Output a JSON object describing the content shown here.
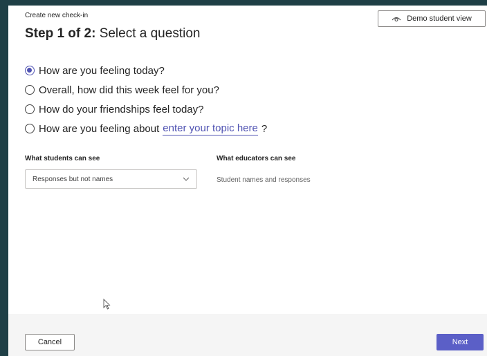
{
  "header": {
    "eyebrow": "Create new check-in",
    "step_prefix": "Step 1 of 2:",
    "step_title": "Select a question",
    "demo_button_label": "Demo student view",
    "demo_icon": "eye-icon"
  },
  "questions": [
    {
      "label": "How are you feeling today?",
      "selected": true
    },
    {
      "label": "Overall, how did this week feel for you?",
      "selected": false
    },
    {
      "label": "How do your friendships feel today?",
      "selected": false
    },
    {
      "label_prefix": "How are you feeling about",
      "topic_placeholder": "enter your topic here",
      "label_suffix": "?",
      "selected": false
    }
  ],
  "visibility": {
    "students_label": "What students can see",
    "students_value": "Responses but not names",
    "students_dropdown_icon": "chevron-down-icon",
    "educators_label": "What educators can see",
    "educators_value": "Student names and responses"
  },
  "footer": {
    "cancel_label": "Cancel",
    "next_label": "Next"
  },
  "colors": {
    "accent": "#5b5fc7",
    "link": "#4f52b2",
    "backdrop": "#1f3f46",
    "footer_bg": "#f5f5f5"
  }
}
